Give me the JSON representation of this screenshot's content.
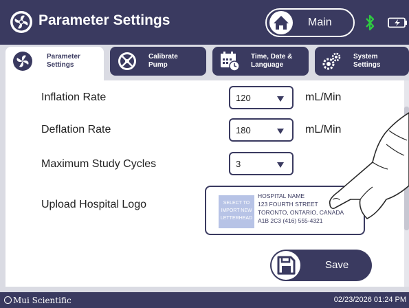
{
  "header": {
    "title": "Parameter Settings",
    "main_label": "Main",
    "icons": [
      "settings-fan-icon",
      "home-icon",
      "bluetooth-icon",
      "battery-icon"
    ]
  },
  "tabs": [
    {
      "label": "Parameter\nSettings",
      "icon": "settings-fan-icon",
      "active": true
    },
    {
      "label": "Calibrate\nPump",
      "icon": "calibrate-icon",
      "active": false
    },
    {
      "label": "Time, Date &\nLanguage",
      "icon": "calendar-clock-icon",
      "active": false
    },
    {
      "label": "System\nSettings",
      "icon": "gears-icon",
      "active": false
    }
  ],
  "settings": {
    "inflation": {
      "label": "Inflation Rate",
      "value": "120",
      "unit": "mL/Min"
    },
    "deflation": {
      "label": "Deflation Rate",
      "value": "180",
      "unit": "mL/Min"
    },
    "cycles": {
      "label": "Maximum Study Cycles",
      "value": "3"
    },
    "logo": {
      "label": "Upload Hospital Logo",
      "select_text": "SELECT TO\nIMPORT NEW\nLETTERHEAD",
      "letterhead": "HOSPITAL NAME\n123 FOURTH STREET\nTORONTO, ONTARIO, CANADA\nA1B 2C3  (416) 555-4321"
    }
  },
  "save_label": "Save",
  "footer": {
    "brand": "Mui Scientific",
    "datetime": "02/23/2026 01:24 PM"
  },
  "colors": {
    "primary": "#3a3a60",
    "background": "#dadbe3",
    "panel": "#ffffff",
    "accent_bluetooth": "#2ecc40",
    "logo_placeholder": "#b7c3e6"
  }
}
